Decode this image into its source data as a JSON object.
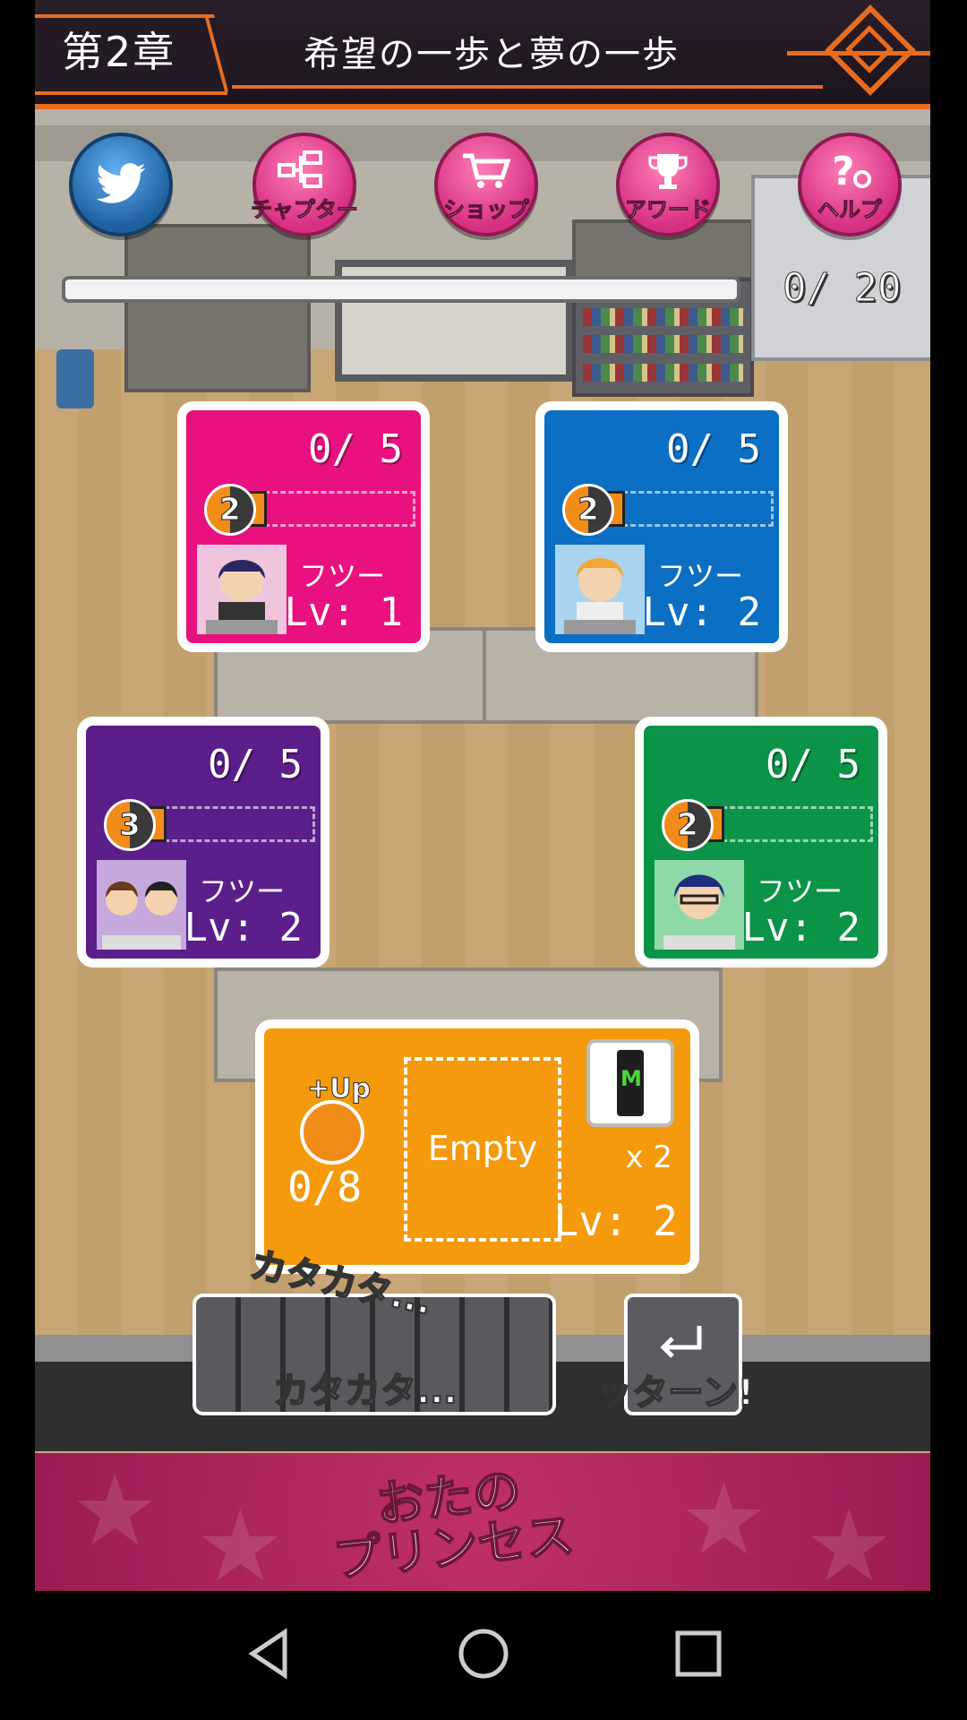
{
  "header": {
    "chapter": "第2章",
    "title": "希望の一歩と夢の一歩"
  },
  "top_buttons": [
    {
      "name": "twitter",
      "label": ""
    },
    {
      "name": "chapter",
      "label": "チャプター"
    },
    {
      "name": "shop",
      "label": "ショップ"
    },
    {
      "name": "award",
      "label": "アワード"
    },
    {
      "name": "help",
      "label": "ヘルプ"
    }
  ],
  "stage_progress": {
    "text": "0/ 20",
    "fraction": 0.0
  },
  "cards": [
    {
      "color": "#e8117f",
      "count": "0/ 5",
      "coin": "2",
      "type": "フツー",
      "level": "Lv: 1"
    },
    {
      "color": "#0b6fc4",
      "count": "0/ 5",
      "coin": "2",
      "type": "フツー",
      "level": "Lv: 2"
    },
    {
      "color": "#5b1e8a",
      "count": "0/ 5",
      "coin": "3",
      "type": "フツー",
      "level": "Lv: 2"
    },
    {
      "color": "#0b9447",
      "count": "0/ 5",
      "coin": "2",
      "type": "フツー",
      "level": "Lv: 2"
    }
  ],
  "booster_card": {
    "up_label": "+Up",
    "progress": "0/8",
    "slot": "Empty",
    "quantity": "x 2",
    "level": "Lv: 2"
  },
  "controls": {
    "keyboard_top": "カタカタ...",
    "keyboard_bottom": "カタカタ...",
    "enter_label": "ッターン!"
  },
  "banner": {
    "logo_line1": "おたの",
    "logo_line2": "プリンセス"
  }
}
